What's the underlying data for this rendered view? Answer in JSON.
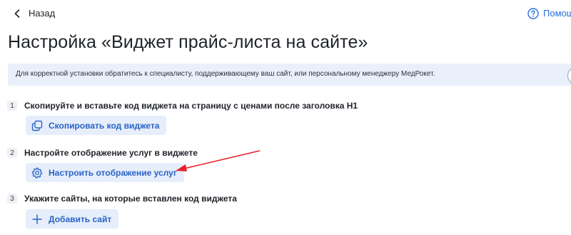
{
  "header": {
    "back_label": "Назад",
    "help_label": "Помощь"
  },
  "page": {
    "title": "Настройка «Виджет прайс-листа на сайте»"
  },
  "notice": {
    "text": "Для корректной установки обратитесь к специалисту, поддерживающему ваш сайт, или персональному менеджеру МедРокет."
  },
  "steps": [
    {
      "number": "1",
      "text": "Скопируйте и вставьте код виджета на страницу с ценами после заголовка H1",
      "button_label": "Скопировать код виджета",
      "button_icon": "copy-icon"
    },
    {
      "number": "2",
      "text": "Настройте отображение услуг в виджете",
      "button_label": "Настроить отображение услуг",
      "button_icon": "gear-icon"
    },
    {
      "number": "3",
      "text": "Укажите сайты, на которые вставлен код виджета",
      "button_label": "Добавить сайт",
      "button_icon": "plus-icon"
    }
  ],
  "colors": {
    "accent": "#2a63c4",
    "button_bg": "#e6eefb",
    "notice_bg": "#eaf0fb",
    "annotation_arrow": "#e8202a"
  }
}
